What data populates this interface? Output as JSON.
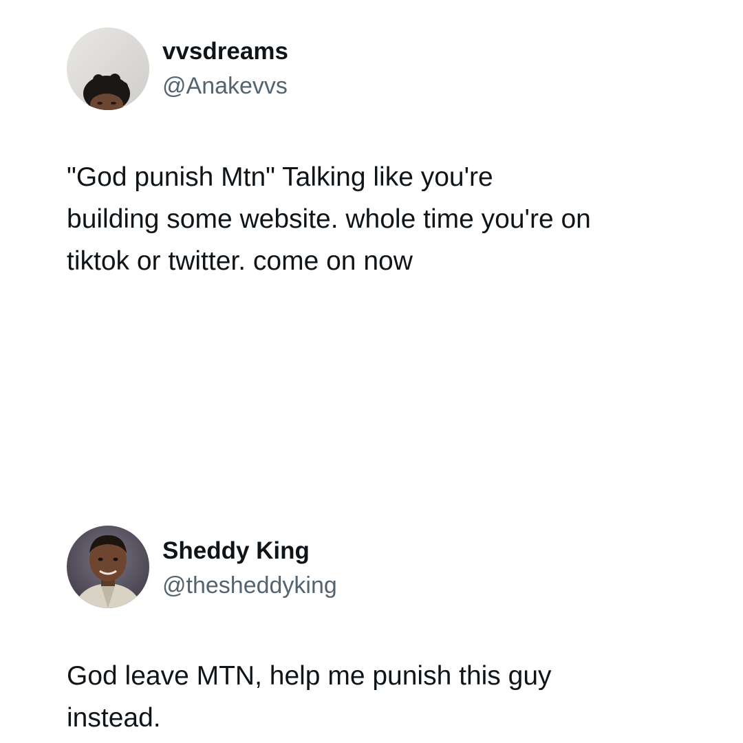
{
  "tweets": [
    {
      "display_name": "vvsdreams",
      "handle": "@Anakevvs",
      "avatar": "profile-photo",
      "text": "\"God punish Mtn\" Talking like you're\nbuilding some website. whole time you're on\ntiktok or twitter. come on now"
    },
    {
      "display_name": "Sheddy King",
      "handle": "@thesheddyking",
      "avatar": "profile-photo",
      "text": "God leave MTN, help me punish this guy\ninstead."
    }
  ],
  "colors": {
    "background": "#ffffff",
    "primary_text": "#0f1419",
    "secondary_text": "#536471"
  }
}
